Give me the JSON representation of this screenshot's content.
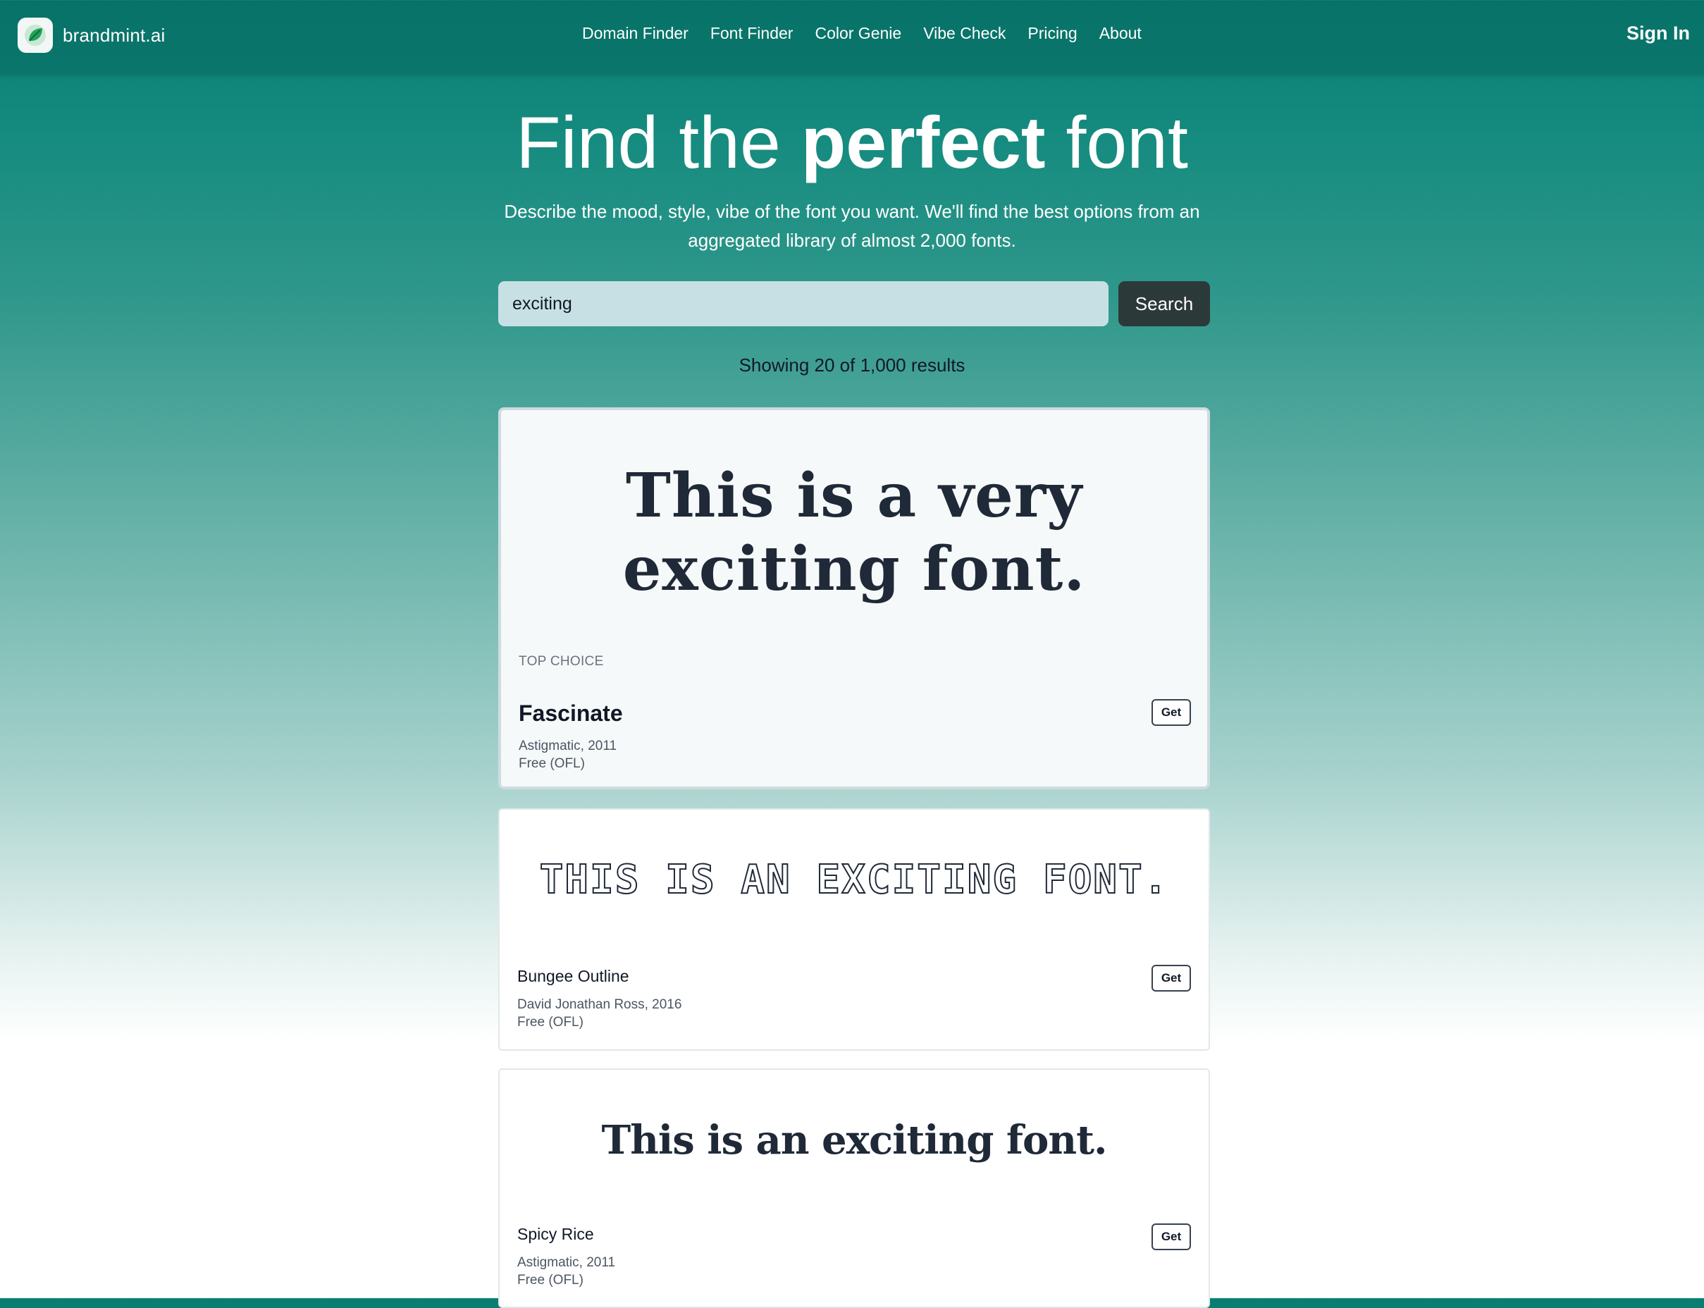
{
  "nav": {
    "brand": "brandmint.ai",
    "logo_icon": "leaf-icon",
    "links": [
      "Domain Finder",
      "Font Finder",
      "Color Genie",
      "Vibe Check",
      "Pricing",
      "About"
    ],
    "sign_in": "Sign In"
  },
  "hero": {
    "title_pre": "Find the ",
    "title_strong": "perfect",
    "title_post": " font",
    "subtitle": "Describe the mood, style, vibe of the font you want. We'll find the best options from an aggregated library of almost 2,000 fonts."
  },
  "search": {
    "value": "exciting",
    "button": "Search"
  },
  "results": {
    "count_text": "Showing 20 of 1,000 results",
    "items": [
      {
        "badge": "TOP CHOICE",
        "preview_line1": "This is a very",
        "preview_line2": "exciting font.",
        "name": "Fascinate",
        "foundry": "Astigmatic, 2011",
        "license": "Free (OFL)",
        "action": "Get"
      },
      {
        "preview": "THIS IS AN EXCITING FONT.",
        "name": "Bungee Outline",
        "foundry": "David Jonathan Ross, 2016",
        "license": "Free (OFL)",
        "action": "Get"
      },
      {
        "preview": "This is an exciting font.",
        "name": "Spicy Rice",
        "foundry": "Astigmatic, 2011",
        "license": "Free (OFL)",
        "action": "Get"
      }
    ]
  },
  "colors": {
    "header_teal": "#0a7d72",
    "button_dark": "#2b3a38",
    "search_bg": "#c7e0e4",
    "text_dark": "#1f2937"
  }
}
